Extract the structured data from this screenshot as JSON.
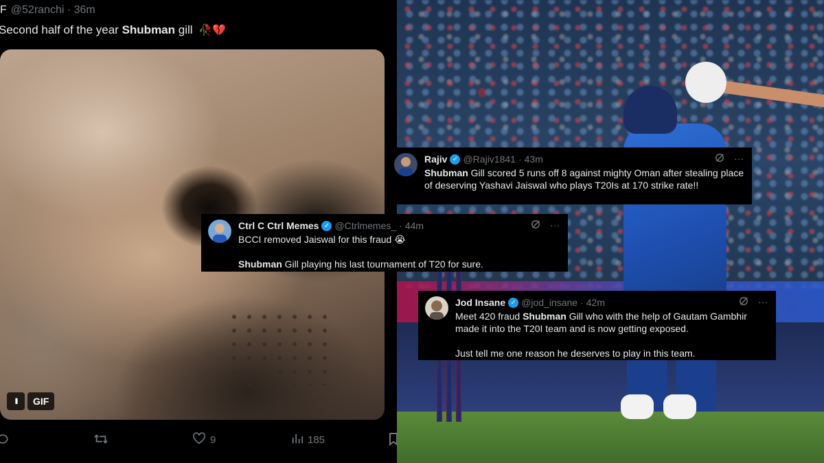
{
  "left_tweet": {
    "user_flag": "F",
    "handle": "@52ranchi",
    "time": "36m",
    "text_before": "Second half of the year",
    "text_bold": "Shubman",
    "text_after": "gill",
    "emojis": "🥀💔",
    "gif_pause": "II",
    "gif_label": "GIF",
    "actions": {
      "reply_count": "",
      "retweet_count": "",
      "like_count": "9",
      "views_count": "185"
    }
  },
  "tweets": [
    {
      "name": "Rajiv",
      "handle": "@Rajiv1841",
      "time": "43m",
      "text_bold": "Shubman",
      "text_rest": " Gill scored 5 runs off 8 against mighty Oman after stealing place of deserving Yashavi Jaiswal who plays T20Is at 170 strike rate!!"
    },
    {
      "name": "Ctrl C Ctrl Memes",
      "handle": "@Ctrlmemes_",
      "time": "44m",
      "line1": "BCCI removed Jaiswal for this fraud 😭",
      "text_bold": "Shubman",
      "text_rest": " Gill playing his last tournament of T20 for sure."
    },
    {
      "name": "Jod Insane",
      "handle": "@jod_insane",
      "time": "42m",
      "text_pre": "Meet 420 fraud ",
      "text_bold": "Shubman",
      "text_rest": " Gill who with the help of Gautam Gambhir made it into the T20I team and is now getting exposed.",
      "line2": "Just tell me one reason he deserves to play in this team."
    }
  ],
  "icons": {
    "verified": "verified-badge-icon",
    "grok": "grok-icon",
    "more": "more-icon",
    "reply": "reply-icon",
    "retweet": "retweet-icon",
    "like": "heart-icon",
    "views": "views-icon",
    "share": "share-icon"
  },
  "colors": {
    "tweet_bg": "#000000",
    "text": "#e7e9ea",
    "muted": "#71767b",
    "verified": "#1d9bf0"
  }
}
